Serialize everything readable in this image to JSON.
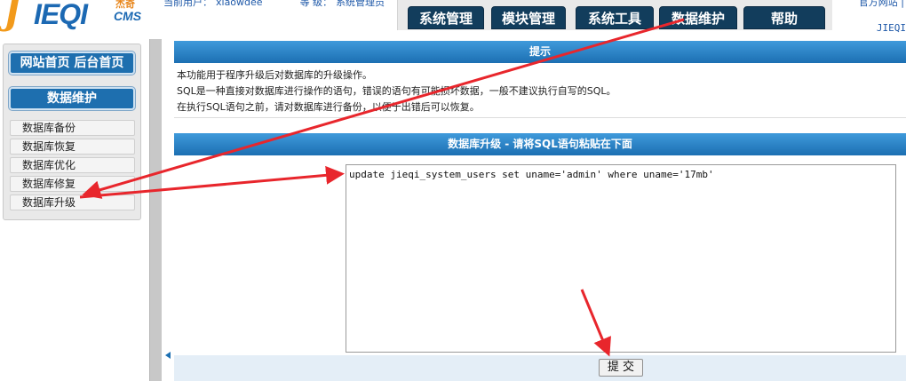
{
  "header": {
    "logo": {
      "mark": "J",
      "main": "IEQI",
      "cn": "杰奇",
      "cms": "CMS"
    },
    "current_user_label": "当前用户：",
    "current_user": "xiaowdee",
    "level_label": "等  级：",
    "level": "系统管理员",
    "official_link": "官方网站 |",
    "version": "JIEQI",
    "tabs": [
      {
        "label": "系统管理"
      },
      {
        "label": "模块管理"
      },
      {
        "label": "系统工具"
      },
      {
        "label": "数据维护"
      },
      {
        "label": "帮助"
      }
    ]
  },
  "sidebar": {
    "home_label": "网站首页  后台首页",
    "section_label": "数据维护",
    "items": [
      {
        "label": "数据库备份"
      },
      {
        "label": "数据库恢复"
      },
      {
        "label": "数据库优化"
      },
      {
        "label": "数据库修复"
      },
      {
        "label": "数据库升级"
      }
    ]
  },
  "main": {
    "tip_title": "提示",
    "tip_lines": [
      "本功能用于程序升级后对数据库的升级操作。",
      "SQL是一种直接对数据库进行操作的语句，错误的语句有可能损坏数据，一般不建议执行自写的SQL。",
      "在执行SQL语句之前，请对数据库进行备份，以便于出错后可以恢复。"
    ],
    "sql_title": "数据库升级 - 请将SQL语句粘贴在下面",
    "sql_value": "update jieqi_system_users set uname='admin' where uname='17mb'",
    "submit_label": "提 交"
  },
  "colors": {
    "accent_blue": "#1c6fb2",
    "nav_tab": "#123d5c",
    "annotation_red": "#e8262c"
  },
  "icons": {
    "collapse": "triangle-left-icon",
    "resize": "resize-grip-icon"
  }
}
